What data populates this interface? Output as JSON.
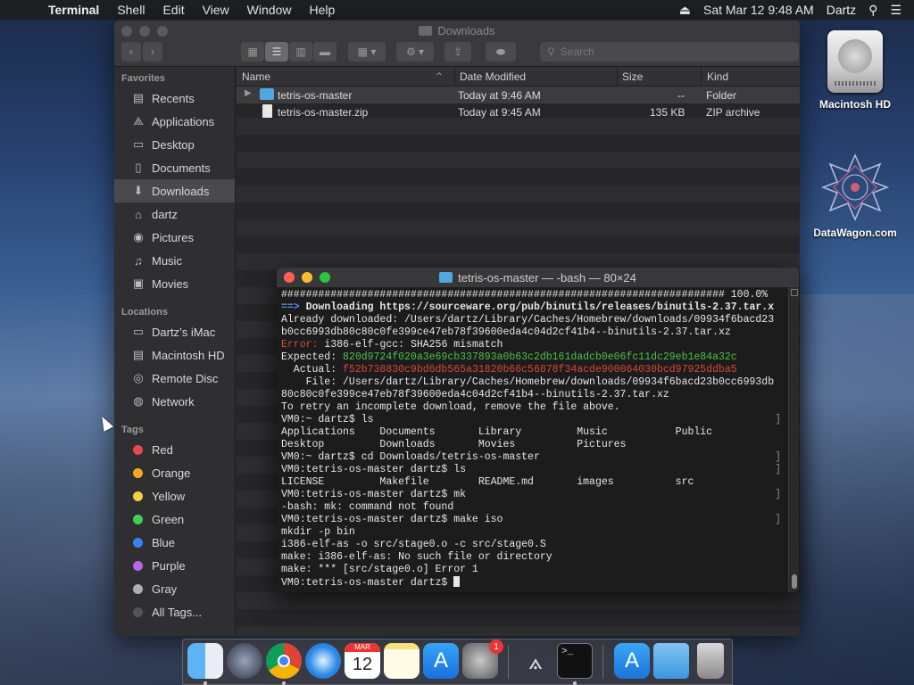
{
  "menubar": {
    "app_name": "Terminal",
    "menus": [
      "Shell",
      "Edit",
      "View",
      "Window",
      "Help"
    ],
    "datetime": "Sat Mar 12  9:48 AM",
    "user": "Dartz"
  },
  "desktop": {
    "icons": [
      {
        "label": "Macintosh HD"
      },
      {
        "label": "DataWagon.com"
      }
    ]
  },
  "finder": {
    "title": "Downloads",
    "search_placeholder": "Search",
    "sidebar": {
      "favorites_heading": "Favorites",
      "favorites": [
        {
          "label": "Recents",
          "icon": "recents-icon"
        },
        {
          "label": "Applications",
          "icon": "applications-icon"
        },
        {
          "label": "Desktop",
          "icon": "desktop-icon"
        },
        {
          "label": "Documents",
          "icon": "documents-icon"
        },
        {
          "label": "Downloads",
          "icon": "downloads-icon"
        },
        {
          "label": "dartz",
          "icon": "home-icon"
        },
        {
          "label": "Pictures",
          "icon": "pictures-icon"
        },
        {
          "label": "Music",
          "icon": "music-icon"
        },
        {
          "label": "Movies",
          "icon": "movies-icon"
        }
      ],
      "locations_heading": "Locations",
      "locations": [
        {
          "label": "Dartz’s iMac",
          "icon": "imac-icon"
        },
        {
          "label": "Macintosh HD",
          "icon": "disk-icon"
        },
        {
          "label": "Remote Disc",
          "icon": "disc-icon"
        },
        {
          "label": "Network",
          "icon": "network-icon"
        }
      ],
      "tags_heading": "Tags",
      "tags": [
        {
          "label": "Red",
          "color": "#e5484d"
        },
        {
          "label": "Orange",
          "color": "#f5a623"
        },
        {
          "label": "Yellow",
          "color": "#f4d03f"
        },
        {
          "label": "Green",
          "color": "#3ed05a"
        },
        {
          "label": "Blue",
          "color": "#3b82f6"
        },
        {
          "label": "Purple",
          "color": "#b667e8"
        },
        {
          "label": "Gray",
          "color": "#b0b0b0"
        },
        {
          "label": "All Tags...",
          "color": "#555555"
        }
      ]
    },
    "columns": {
      "name": "Name",
      "date": "Date Modified",
      "size": "Size",
      "kind": "Kind"
    },
    "files": [
      {
        "name": "tetris-os-master",
        "date": "Today at 9:46 AM",
        "size": "--",
        "kind": "Folder"
      },
      {
        "name": "tetris-os-master.zip",
        "date": "Today at 9:45 AM",
        "size": "135 KB",
        "kind": "ZIP archive"
      }
    ]
  },
  "terminal": {
    "title": "tetris-os-master — -bash — 80×24",
    "lines": {
      "l1": "######################################################################## 100.0%",
      "l2_arrow": "==>",
      "l2_text": " Downloading https://sourceware.org/pub/binutils/releases/binutils-2.37.tar.x",
      "l3": "Already downloaded: /Users/dartz/Library/Caches/Homebrew/downloads/09934f6bacd23",
      "l4": "b0cc6993db80c80c0fe399ce47eb78f39600eda4c04d2cf41b4--binutils-2.37.tar.xz",
      "l5_label": "Error:",
      "l5_text": " i386-elf-gcc: SHA256 mismatch",
      "l6_label": "Expected: ",
      "l6_hash": "820d9724f020a3e69cb337893a0b63c2db161dadcb0e06fc11dc29eb1e84a32c",
      "l7_label": "  Actual: ",
      "l7_hash": "f52b738830c9bd6db565a31820b66c56878f34acde900064030bcd97925ddba5",
      "l8": "    File: /Users/dartz/Library/Caches/Homebrew/downloads/09934f6bacd23b0cc6993db",
      "l9": "80c80c0fe399ce47eb78f39600eda4c04d2cf41b4--binutils-2.37.tar.xz",
      "l10": "To retry an incomplete download, remove the file above.",
      "l11": "VM0:~ dartz$ ls",
      "l12": "Applications    Documents       Library         Music           Public",
      "l13": "Desktop         Downloads       Movies          Pictures",
      "l14": "VM0:~ dartz$ cd Downloads/tetris-os-master",
      "l15": "VM0:tetris-os-master dartz$ ls",
      "l16": "LICENSE         Makefile        README.md       images          src",
      "l17": "VM0:tetris-os-master dartz$ mk",
      "l18": "-bash: mk: command not found",
      "l19": "VM0:tetris-os-master dartz$ make iso",
      "l20": "mkdir -p bin",
      "l21": "i386-elf-as -o src/stage0.o -c src/stage0.S",
      "l22": "make: i386-elf-as: No such file or directory",
      "l23": "make: *** [src/stage0.o] Error 1",
      "l24": "VM0:tetris-os-master dartz$ "
    },
    "bracket": "]"
  },
  "dock": {
    "items": [
      {
        "name": "finder"
      },
      {
        "name": "launchpad"
      },
      {
        "name": "chrome"
      },
      {
        "name": "safari"
      },
      {
        "name": "calendar",
        "month": "MAR",
        "day": "12"
      },
      {
        "name": "notes"
      },
      {
        "name": "app-store"
      },
      {
        "name": "system-preferences",
        "badge": "1"
      },
      {
        "name": "font-tool"
      },
      {
        "name": "terminal",
        "glyph": ">_"
      },
      {
        "name": "applications-folder"
      },
      {
        "name": "downloads-folder"
      },
      {
        "name": "trash"
      }
    ]
  }
}
